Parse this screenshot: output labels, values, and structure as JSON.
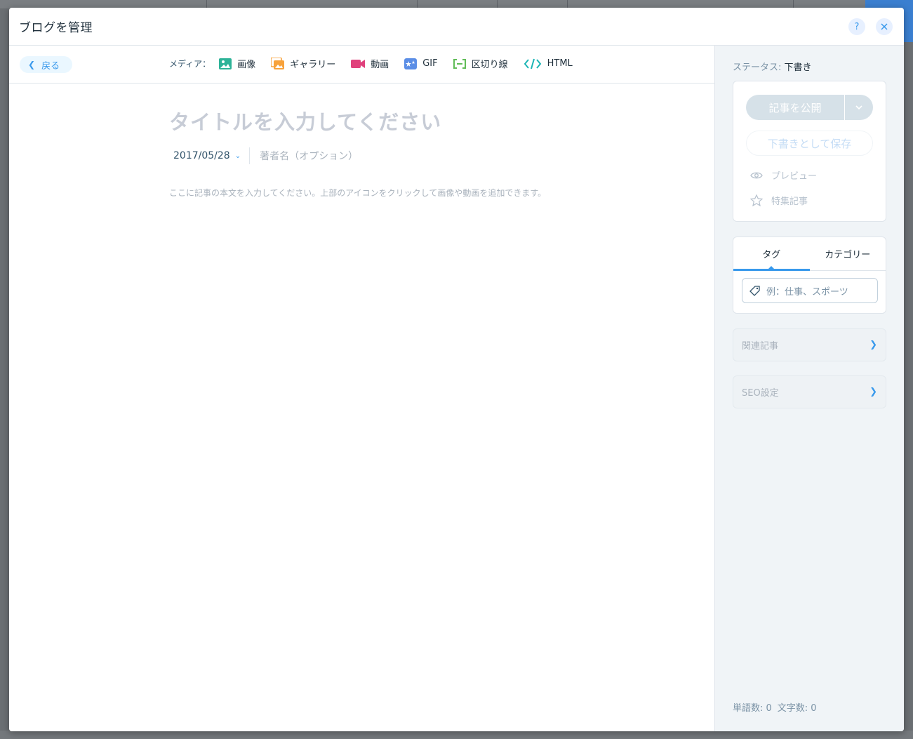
{
  "window": {
    "title": "ブログを管理",
    "help_icon": "help-icon",
    "close_icon": "close-icon"
  },
  "toolbar": {
    "back_label": "戻る",
    "media_label": "メディア：",
    "media_items": [
      {
        "label": "画像",
        "icon": "image-icon",
        "color": "#2eb398"
      },
      {
        "label": "ギャラリー",
        "icon": "gallery-icon",
        "color": "#f7a23b"
      },
      {
        "label": "動画",
        "icon": "video-icon",
        "color": "#e0417c"
      },
      {
        "label": "GIF",
        "icon": "gif-icon",
        "color": "#5b8ee6"
      },
      {
        "label": "区切り線",
        "icon": "divider-icon",
        "color": "#60bc57"
      },
      {
        "label": "HTML",
        "icon": "html-code-icon",
        "color": "#1cb5b5"
      }
    ]
  },
  "editor": {
    "title_placeholder": "タイトルを入力してください",
    "date": "2017/05/28",
    "author_placeholder": "著者名（オプション）",
    "body_placeholder": "ここに記事の本文を入力してください。上部のアイコンをクリックして画像や動画を追加できます。"
  },
  "sidebar": {
    "status_label": "ステータス:",
    "status_value": "下書き",
    "publish_label": "記事を公開",
    "save_draft_label": "下書きとして保存",
    "preview_label": "プレビュー",
    "featured_label": "特集記事",
    "tabs": [
      "タグ",
      "カテゴリー"
    ],
    "tag_placeholder": "例：仕事、スポーツ",
    "related_label": "関連記事",
    "seo_label": "SEO設定",
    "word_count": "単語数: 0",
    "char_count": "文字数: 0"
  },
  "colors": {
    "accent": "#3899ec"
  }
}
